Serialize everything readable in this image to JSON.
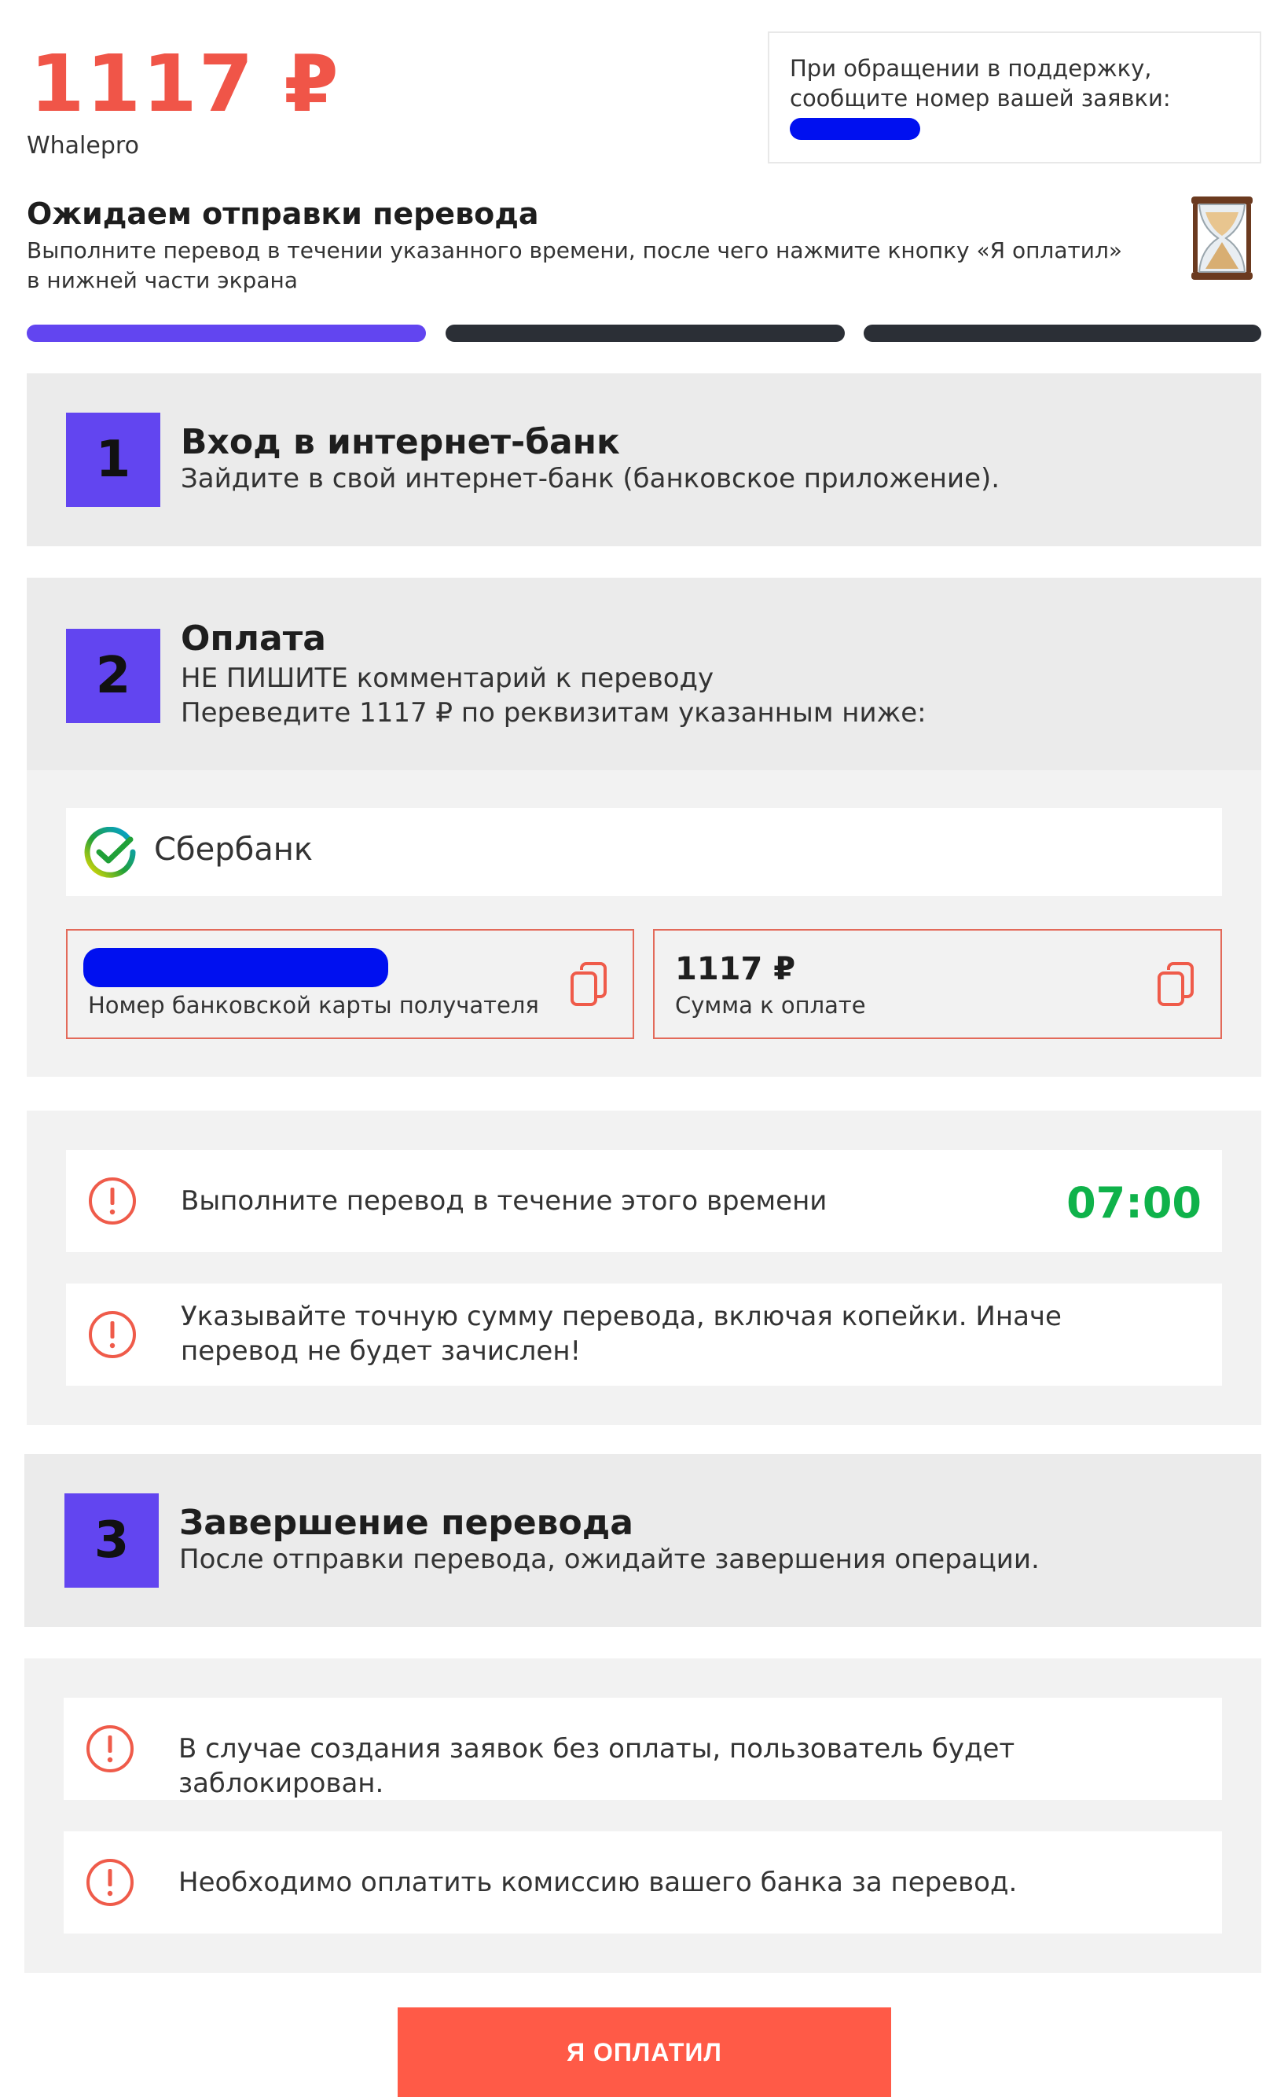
{
  "header": {
    "amount": "1117 ₽",
    "merchant": "Whalepro",
    "support_text": "При обращении в поддержку, сообщите номер вашей заявки:"
  },
  "status": {
    "title": "Ожидаем отправки перевода",
    "description": "Выполните перевод в течении указанного времени, после чего нажмите кнопку «Я оплатил» в нижней части экрана",
    "progress_steps_total": 3,
    "progress_steps_done": 1
  },
  "step1": {
    "number": "1",
    "title": "Вход в интернет-банк",
    "text": "Зайдите в свой интернет-банк (банковское приложение)."
  },
  "step2": {
    "number": "2",
    "title": "Оплата",
    "line1": "НЕ ПИШИТЕ комментарий к переводу",
    "line2": "Переведите 1117 ₽ по реквизитам указанным ниже:",
    "bank_name": "Сбербанк",
    "card_label": "Номер банковской карты получателя",
    "sum_value": "1117 ₽",
    "sum_label": "Сумма к оплате"
  },
  "alerts_a": {
    "timer_text": "Выполните перевод в течение этого времени",
    "timer_value": "07:00",
    "exact_sum_text": "Указывайте точную сумму перевода, включая копейки. Иначе перевод не будет зачислен!"
  },
  "step3": {
    "number": "3",
    "title": "Завершение перевода",
    "text": "После отправки перевода, ожидайте завершения операции."
  },
  "alerts_b": {
    "block_text": "В случае создания заявок без оплаты, пользователь будет заблокирован.",
    "fee_text": "Необходимо оплатить комиссию вашего банка за перевод."
  },
  "action": {
    "paid_label": "Я ОПЛАТИЛ"
  },
  "colors": {
    "accent": "#f05548",
    "step_purple": "#6245f0",
    "timer_green": "#0fb24a",
    "button": "#ff5a47"
  }
}
